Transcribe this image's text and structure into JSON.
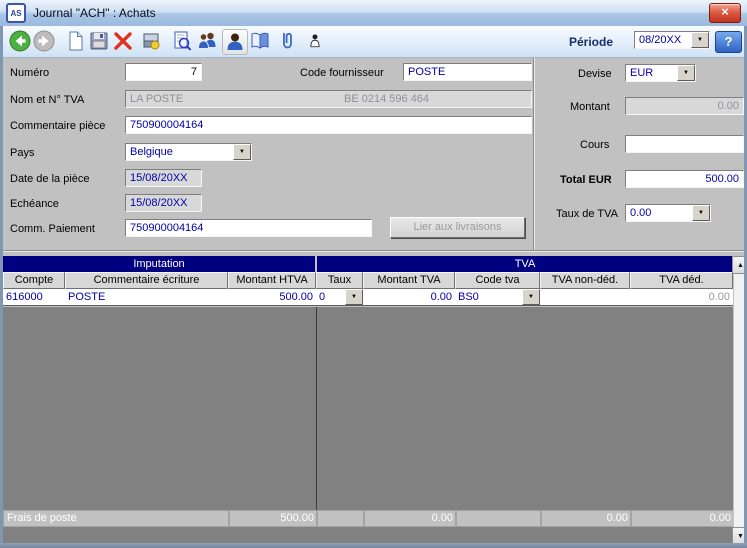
{
  "window": {
    "title": "Journal \"ACH\" : Achats",
    "app_badge": "AS",
    "close_glyph": "×"
  },
  "toolbar": {
    "icons": [
      "back",
      "forward",
      "new-document",
      "save",
      "delete",
      "payment",
      "print-preview",
      "contacts",
      "user",
      "journal-book",
      "attachment",
      "person"
    ],
    "periode_label": "Période",
    "periode_value": "08/20XX",
    "help_label": "?",
    "dropdown_glyph": "▼"
  },
  "form": {
    "numero_label": "Numéro",
    "numero_value": "7",
    "code_fournisseur_label": "Code fournisseur",
    "code_fournisseur_value": "POSTE",
    "nom_tva_label": "Nom et N° TVA",
    "nom_value": "LA POSTE",
    "tva_value": "BE 0214 596 464",
    "commentaire_piece_label": "Commentaire pièce",
    "commentaire_piece_value": "750900004164",
    "pays_label": "Pays",
    "pays_value": "Belgique",
    "date_piece_label": "Date de la pièce",
    "date_piece_value": "15/08/20XX",
    "echeance_label": "Echéance",
    "echeance_value": "15/08/20XX",
    "comm_paiement_label": "Comm. Paiement",
    "comm_paiement_value": "750900004164",
    "lier_button_label": "Lier aux livraisons",
    "devise_label": "Devise",
    "devise_value": "EUR",
    "montant_label": "Montant",
    "montant_value": "0.00",
    "cours_label": "Cours",
    "cours_value": "",
    "total_label": "Total EUR",
    "total_value": "500.00",
    "taux_tva_label": "Taux de TVA",
    "taux_tva_value": "0.00"
  },
  "table": {
    "group_imputation": "Imputation",
    "group_tva": "TVA",
    "columns": [
      "Compte",
      "Commentaire écriture",
      "Montant HTVA",
      "Taux",
      "Montant TVA",
      "Code tva",
      "TVA non-déd.",
      "TVA déd."
    ],
    "row": {
      "compte": "616000",
      "commentaire": "POSTE",
      "montant_htva": "500.00",
      "taux": "0",
      "montant_tva": "0.00",
      "code_tva": "BS0",
      "tva_non_ded": "",
      "tva_ded": "0.00"
    },
    "footer": {
      "label": "Frais de poste",
      "montant_htva": "500.00",
      "montant_tva": "0.00",
      "tva_non_ded": "0.00",
      "tva_ded": "0.00"
    },
    "scroll_up_glyph": "▲",
    "scroll_down_glyph": "▼"
  }
}
